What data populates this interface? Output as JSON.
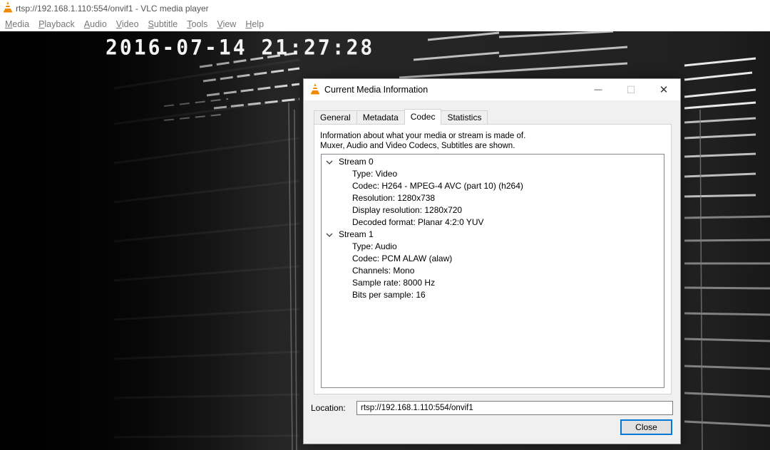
{
  "window": {
    "title": "rtsp://192.168.1.110:554/onvif1 - VLC media player",
    "icon": "vlc-cone-icon"
  },
  "menubar": [
    {
      "mnemonic": "M",
      "rest": "edia"
    },
    {
      "mnemonic": "P",
      "rest": "layback"
    },
    {
      "mnemonic": "A",
      "rest": "udio"
    },
    {
      "mnemonic": "V",
      "rest": "ideo"
    },
    {
      "mnemonic": "S",
      "rest": "ubtitle"
    },
    {
      "mnemonic": "T",
      "rest": "ools"
    },
    {
      "mnemonic": "V",
      "rest": "iew"
    },
    {
      "mnemonic": "H",
      "rest": "elp"
    }
  ],
  "video": {
    "osd_timestamp": "2016-07-14  21:27:28"
  },
  "dialog": {
    "title": "Current Media Information",
    "minimize_glyph": "—",
    "maximize_glyph": "☐",
    "close_glyph": "✕",
    "tabs": [
      {
        "label": "General",
        "active": false
      },
      {
        "label": "Metadata",
        "active": false
      },
      {
        "label": "Codec",
        "active": true
      },
      {
        "label": "Statistics",
        "active": false
      }
    ],
    "info_line1": "Information about what your media or stream is made of.",
    "info_line2": "Muxer, Audio and Video Codecs, Subtitles are shown.",
    "streams": [
      {
        "name": "Stream 0",
        "properties": [
          "Type: Video",
          "Codec: H264 - MPEG-4 AVC (part 10) (h264)",
          "Resolution: 1280x738",
          "Display resolution: 1280x720",
          "Decoded format: Planar 4:2:0 YUV"
        ]
      },
      {
        "name": "Stream 1",
        "properties": [
          "Type: Audio",
          "Codec: PCM ALAW (alaw)",
          "Channels: Mono",
          "Sample rate: 8000 Hz",
          "Bits per sample: 16"
        ]
      }
    ],
    "location_label": "Location:",
    "location_value": "rtsp://192.168.1.110:554/onvif1",
    "close_label": "Close"
  },
  "colors": {
    "vlc_orange": "#f08a00",
    "focus_blue": "#0078d7"
  }
}
